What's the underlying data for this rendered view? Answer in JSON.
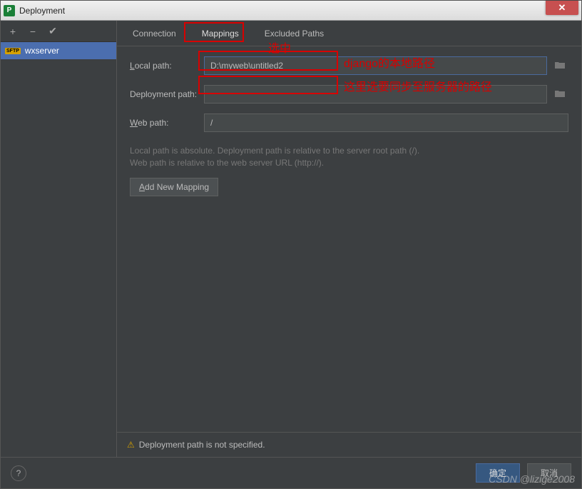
{
  "window": {
    "title": "Deployment"
  },
  "sidebar": {
    "server_name": "wxserver",
    "server_protocol": "SFTP"
  },
  "tabs": {
    "connection": "Connection",
    "mappings": "Mappings",
    "excluded": "Excluded Paths",
    "active": "mappings"
  },
  "form": {
    "local_path_label_pre": "L",
    "local_path_label_post": "ocal path:",
    "local_path_value": "D:\\myweb\\untitled2",
    "deployment_path_label": "Deployment path:",
    "deployment_path_value": "",
    "web_path_label_pre": "W",
    "web_path_label_post": "eb path:",
    "web_path_value": "/",
    "help_line1": "Local path is absolute. Deployment path is relative to the server root path (/).",
    "help_line2": "Web path is relative to the web server URL (http://).",
    "add_mapping_pre": "A",
    "add_mapping_post": "dd New Mapping"
  },
  "warning": {
    "text": "Deployment path is not specified."
  },
  "buttons": {
    "ok": "确定",
    "cancel": "取消"
  },
  "annotations": {
    "tab_note": "选中",
    "local_note": "django的本地路径",
    "deploy_note": "这里选要同步至服务器的路径"
  },
  "watermark": "CSDN @lizige2008"
}
